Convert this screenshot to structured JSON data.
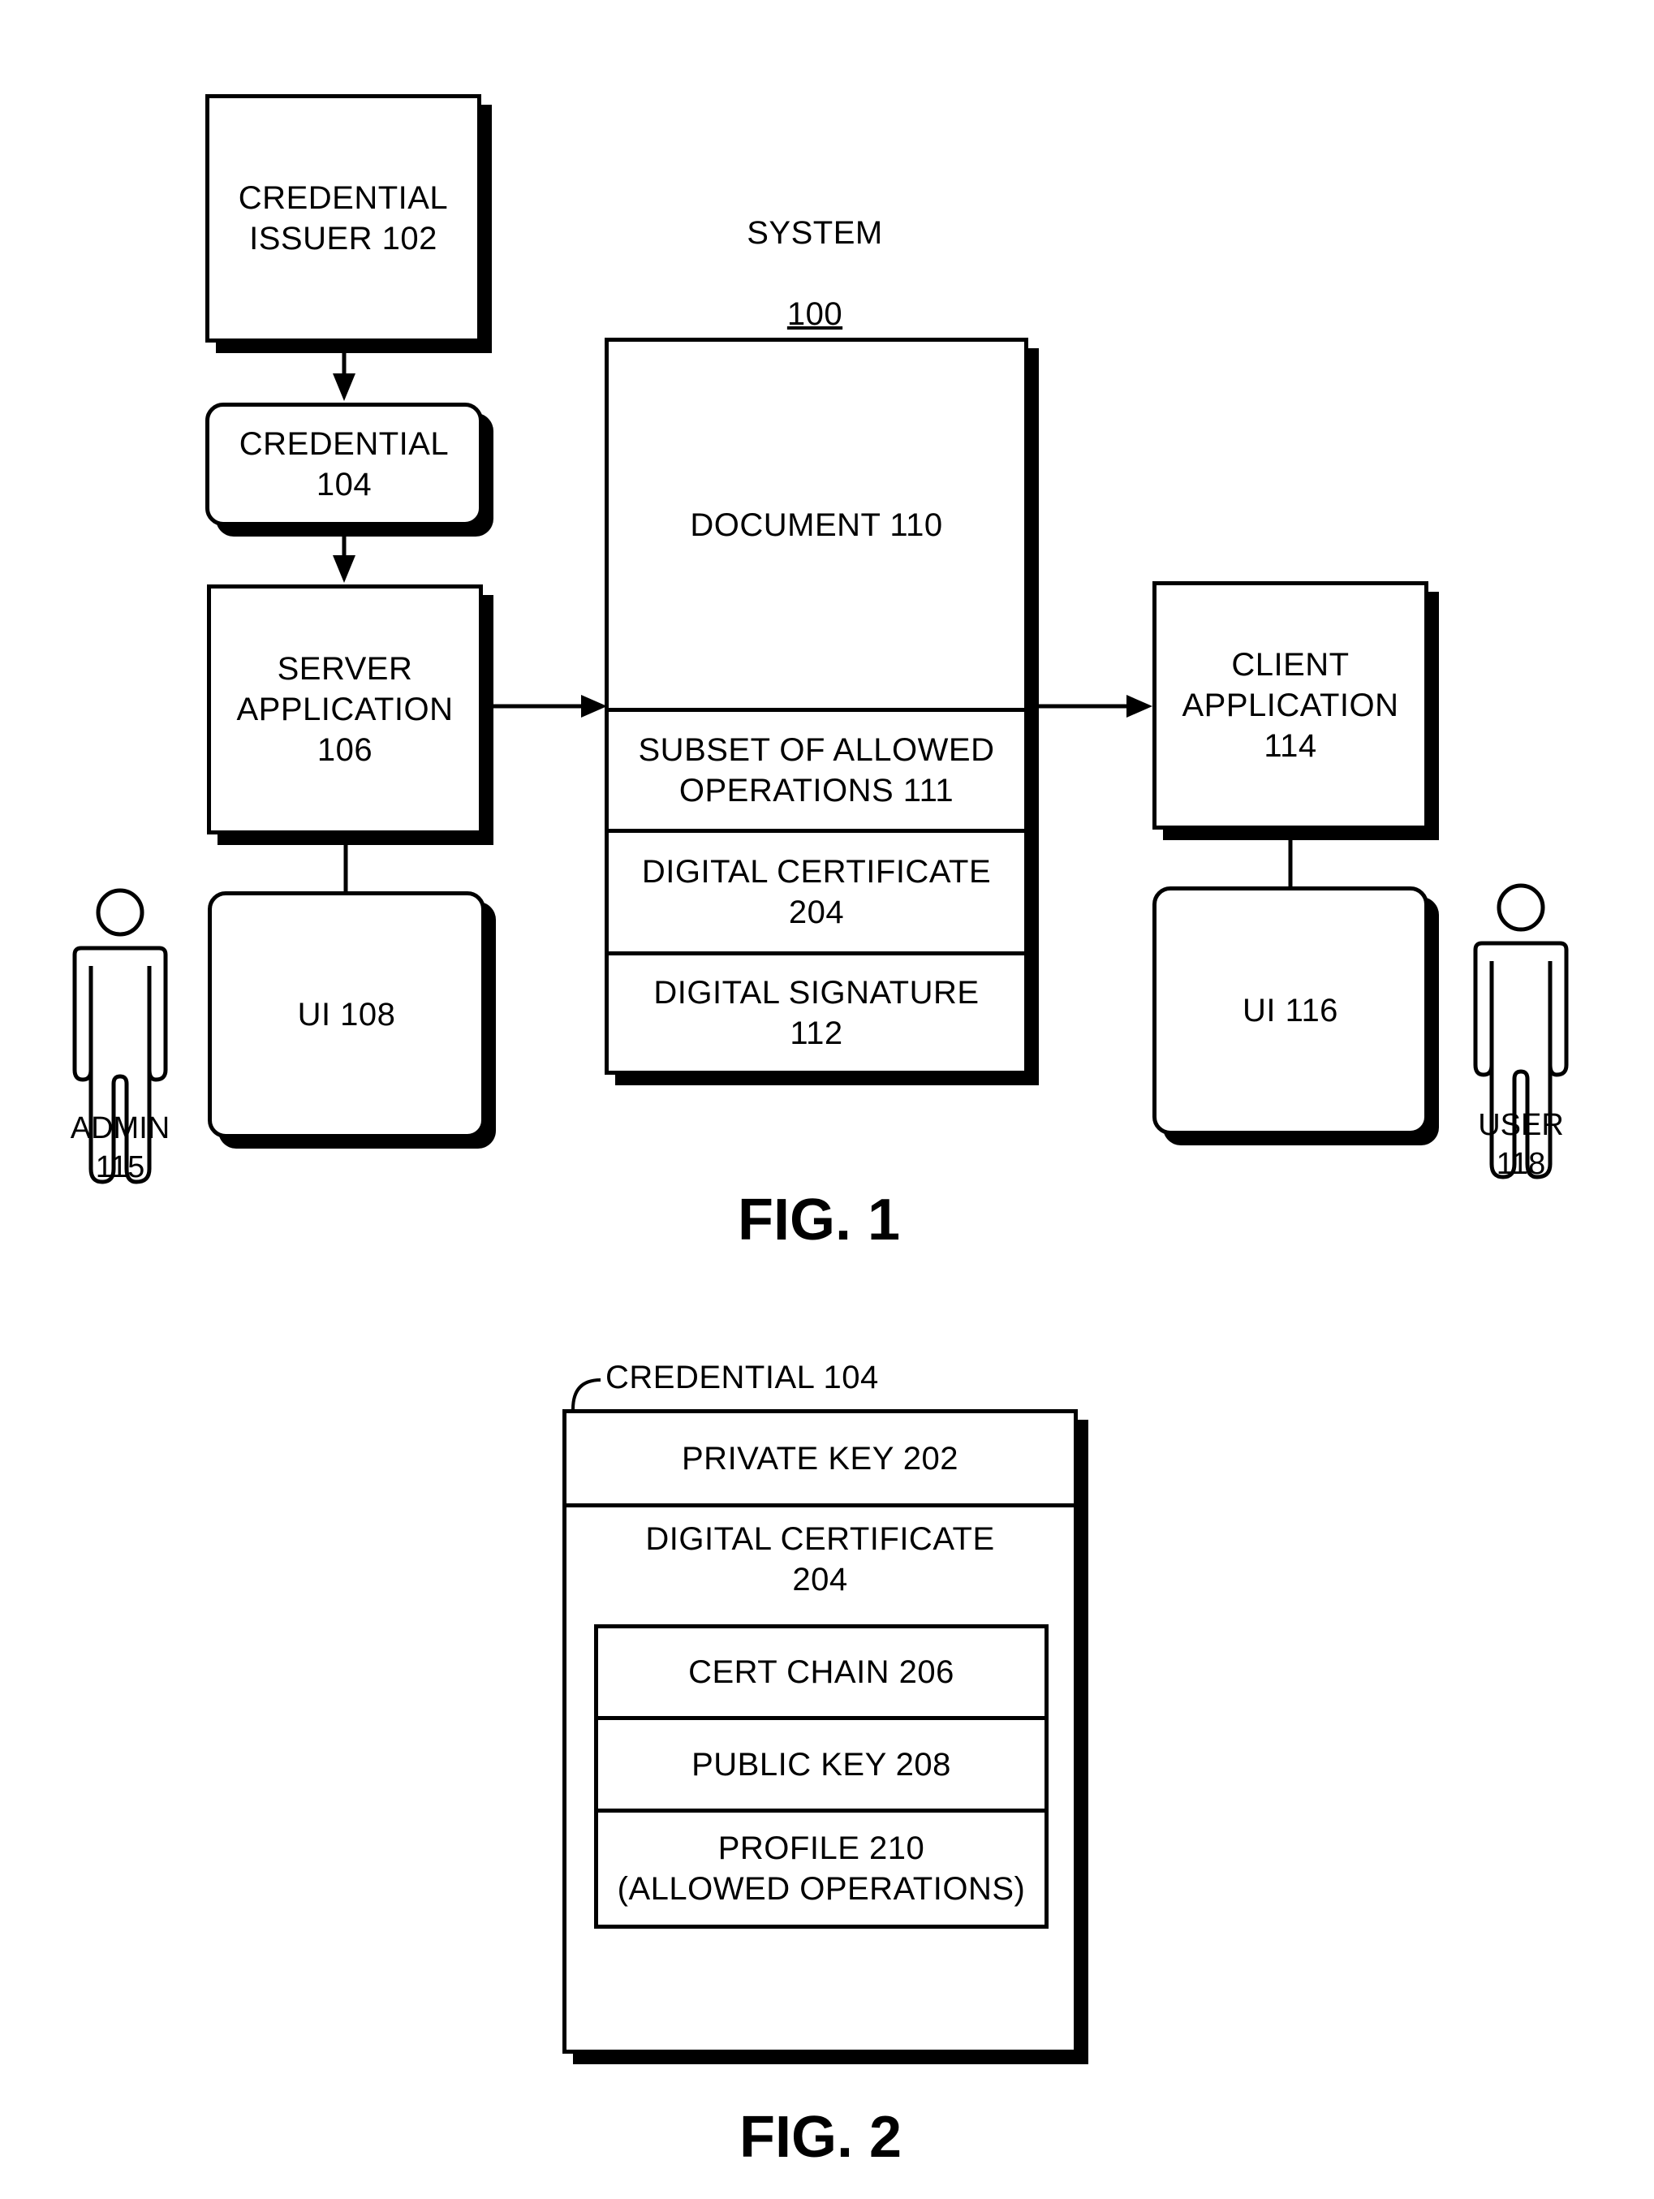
{
  "figure1": {
    "system_label": "SYSTEM",
    "system_number": "100",
    "credential_issuer": "CREDENTIAL\nISSUER  102",
    "credential": "CREDENTIAL\n104",
    "server_application": "SERVER\nAPPLICATION\n106",
    "ui_server": "UI  108",
    "admin": "ADMIN\n115",
    "document": {
      "title": "DOCUMENT  110",
      "sections": [
        "SUBSET OF ALLOWED\nOPERATIONS  111",
        "DIGITAL CERTIFICATE\n204",
        "DIGITAL SIGNATURE\n112"
      ]
    },
    "client_application": "CLIENT\nAPPLICATION\n114",
    "ui_client": "UI  116",
    "user": "USER\n118",
    "caption": "FIG. 1"
  },
  "figure2": {
    "credential_label": "CREDENTIAL  104",
    "private_key": "PRIVATE KEY  202",
    "digital_certificate": "DIGITAL CERTIFICATE\n204",
    "certificate_fields": [
      "CERT CHAIN  206",
      "PUBLIC KEY  208",
      "PROFILE  210\n(ALLOWED OPERATIONS)"
    ],
    "caption": "FIG. 2"
  }
}
